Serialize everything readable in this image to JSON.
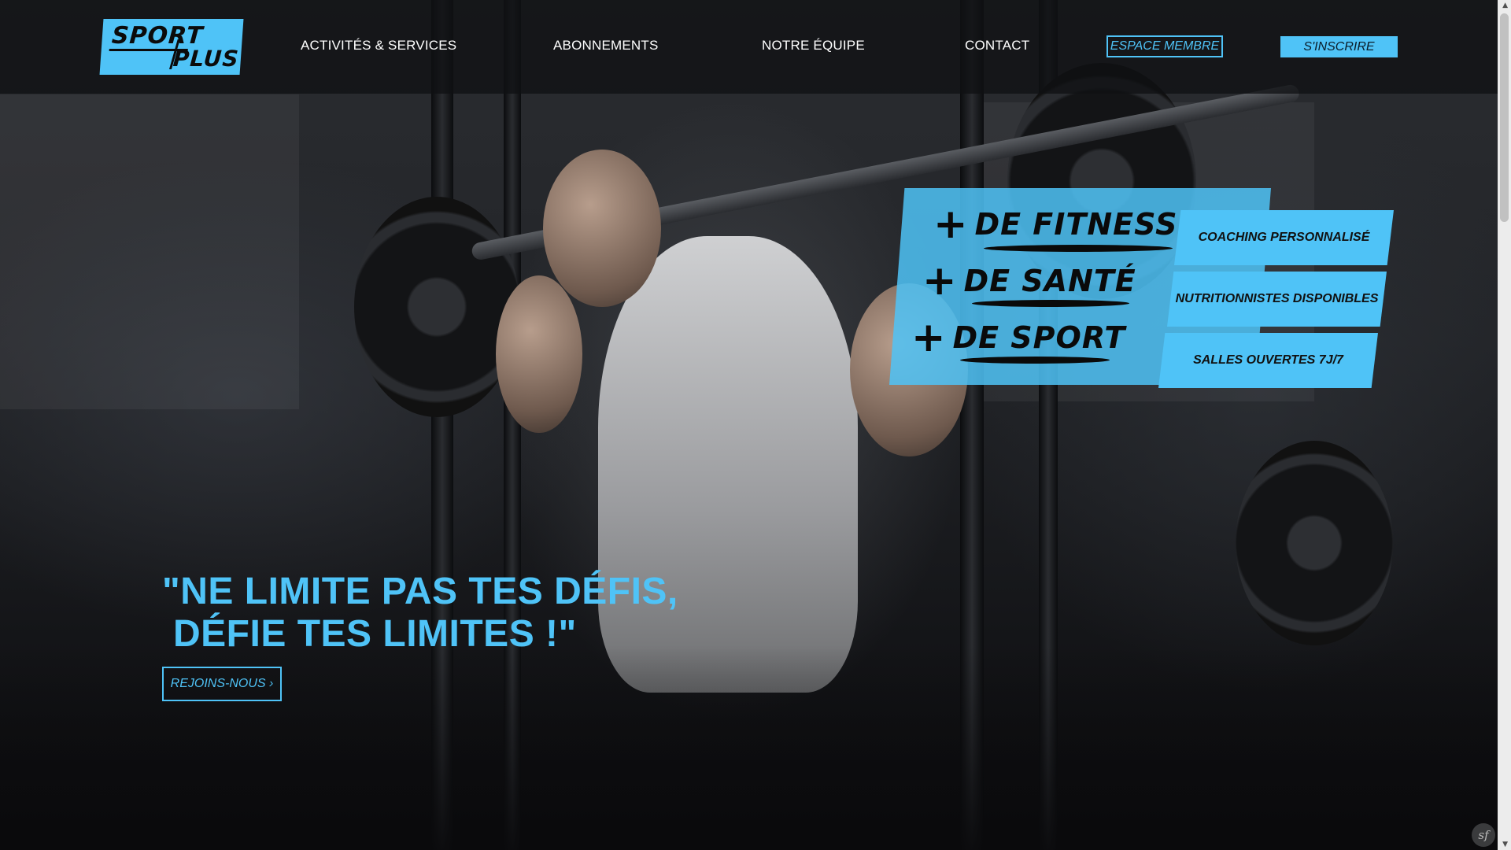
{
  "brand": {
    "logo_line1": "SPORT",
    "logo_line2": "PLUS",
    "accent_color": "#4fc3f7"
  },
  "nav": {
    "items": [
      {
        "label": "ACTIVITÉS & SERVICES"
      },
      {
        "label": "ABONNEMENTS"
      },
      {
        "label": "NOTRE ÉQUIPE"
      },
      {
        "label": "CONTACT"
      }
    ],
    "member_button": "ESPACE MEMBRE",
    "signup_button": "S'INSCRIRE"
  },
  "promo": {
    "plus_symbol": "+",
    "lines": [
      "DE FITNESS",
      "DE SANTÉ",
      "DE SPORT"
    ]
  },
  "features": [
    "COACHING PERSONNALISÉ",
    "NUTRITIONNISTES DISPONIBLES",
    "SALLES OUVERTES 7J/7"
  ],
  "hero": {
    "tagline_line1": "\"NE LIMITE PAS TES DÉFIS,",
    "tagline_line2": "DÉFIE TES LIMITES !\"",
    "cta": "REJOINS-NOUS ›"
  },
  "debug_toolbar": {
    "icon": "symfony-icon",
    "glyph": "sf"
  }
}
